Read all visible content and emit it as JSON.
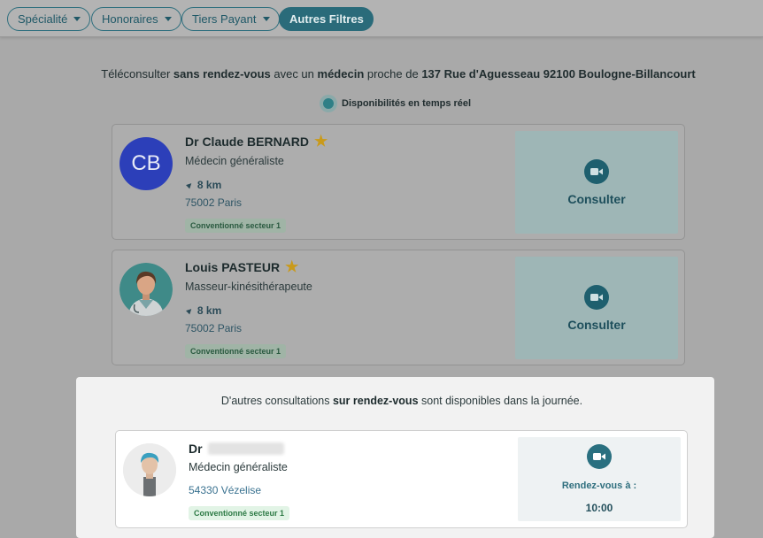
{
  "filters": {
    "speciality": "Spécialité",
    "fees": "Honoraires",
    "third_party": "Tiers Payant",
    "more": "Autres Filtres"
  },
  "intro": {
    "part1": "Téléconsulter ",
    "bold1": "sans rendez-vous",
    "part2": " avec un ",
    "bold2": "médecin",
    "part3": " proche de ",
    "address": "137 Rue d'Aguesseau 92100 Boulogne-Billancourt"
  },
  "realtime_label": "Disponibilités en temps réel",
  "doctors": [
    {
      "initials": "CB",
      "name": "Dr Claude BERNARD",
      "specialty": "Médecin généraliste",
      "distance": "8 km",
      "city": "75002 Paris",
      "badge": "Conventionné secteur 1",
      "cta": "Consulter"
    },
    {
      "name": "Louis PASTEUR",
      "specialty": "Masseur-kinésithérapeute",
      "distance": "8 km",
      "city": "75002 Paris",
      "badge": "Conventionné secteur 1",
      "cta": "Consulter"
    }
  ],
  "appointments": {
    "msg_part1": "D'autres consultations ",
    "msg_bold": "sur rendez-vous",
    "msg_part2": " sont disponibles dans la journée.",
    "doctor": {
      "name_prefix": "Dr",
      "specialty": "Médecin généraliste",
      "city": "54330 Vézelise",
      "badge": "Conventionné secteur 1",
      "rdv_label": "Rendez-vous à :",
      "rdv_time": "10:00"
    }
  },
  "colors": {
    "accent": "#2a6b7a",
    "avatar_initials_bg": "#2c3fb9",
    "star": "#c99a1a",
    "badge_green": "#2d7a45"
  }
}
